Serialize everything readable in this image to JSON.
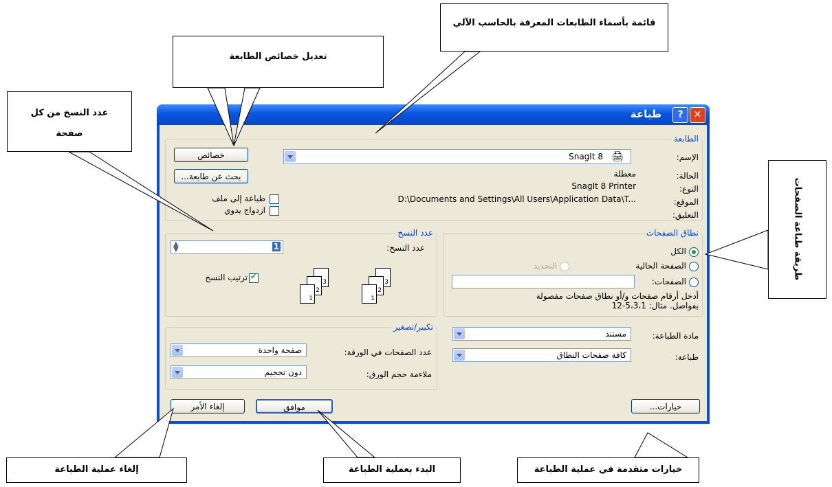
{
  "dialog": {
    "title": "طباعة",
    "help_glyph": "?",
    "close_glyph": "✕",
    "printer": {
      "group_label": "الطابعة",
      "name_label": "الإسم:",
      "name_value": "SnagIt 8",
      "properties_button": "خصائص",
      "find_printer_button": "بحث عن طابعة...",
      "status_label": "الحالة:",
      "status_value": "معطلة",
      "type_label": "النوع:",
      "type_value": "SnagIt 8 Printer",
      "where_label": "الموقع:",
      "where_value": "D:\\Documents and Settings\\All Users\\Application Data\\T...",
      "comment_label": "التعليق:",
      "print_to_file_label": "طباعة إلى ملف",
      "manual_duplex_label": "ازدواج يدوي"
    },
    "page_range": {
      "group_label": "نطاق الصفحات",
      "all_label": "الكل",
      "current_page_label": "الصفحة الحالية",
      "selection_label": "التحديد",
      "pages_label": "الصفحات:",
      "help_text_line1": "أدخل أرقام صفحات و/أو نطاق صفحات مفصولة",
      "help_text_line2": "بفواصل. مثال: 5،3،1-12"
    },
    "copies": {
      "group_label": "عدد النسخ",
      "count_label": "عدد النسخ:",
      "count_value": "1",
      "collate_label": "ترتيب النسخ",
      "collate_checked": true,
      "page_numbers": [
        "1",
        "2",
        "3"
      ]
    },
    "print_what_label": "مادة الطباعة:",
    "print_what_value": "مستند",
    "print_label": "طباعة:",
    "print_value": "كافة صفحات النطاق",
    "zoom": {
      "group_label": "تكبير/تصغير",
      "pages_per_sheet_label": "عدد الصفحات في الورقة:",
      "pages_per_sheet_value": "صفحة واحدة",
      "scale_label": "ملاءمة حجم الورق:",
      "scale_value": "دون تحجيم"
    },
    "options_button": "خيارات...",
    "ok_button": "موافق",
    "cancel_button": "إلغاء الأمر"
  },
  "callouts": {
    "printer_list": "قائمة بأسماء الطابعات المعرفة بالحاسب الآلي",
    "printer_properties": "تعديل خصائص الطابعة",
    "copies_per_page": "عدد النسخ من كل صفحة",
    "page_range_method": "طريقة طباعة الصفحات",
    "cancel_printing": "إلغاء عملية الطباعة",
    "start_printing": "البدء بعملية الطباعة",
    "advanced_options": "خيارات متقدمة في عملية الطباعة"
  }
}
